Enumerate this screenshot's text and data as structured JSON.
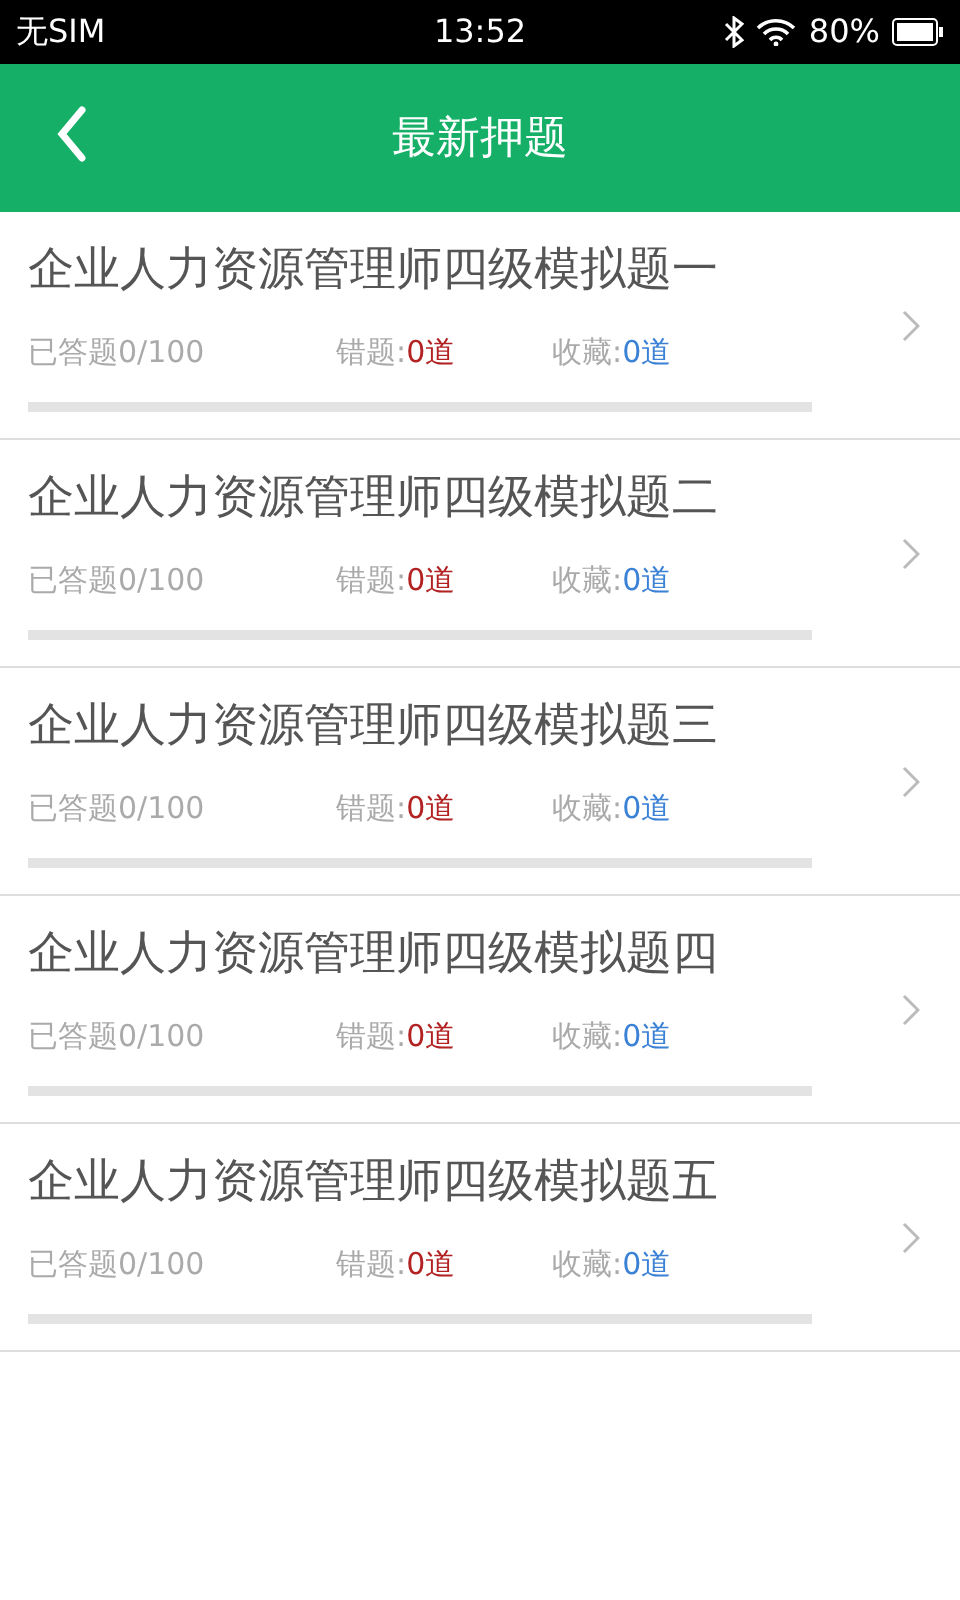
{
  "status_bar": {
    "carrier": "无SIM",
    "time": "13:52",
    "battery": "80%"
  },
  "nav": {
    "title": "最新押题"
  },
  "items": [
    {
      "title": "企业人力资源管理师四级模拟题一",
      "answered": "已答题0/100",
      "wrong_label": "错题:",
      "wrong_value": "0道",
      "fav_label": "收藏:",
      "fav_value": "0道",
      "level": 0
    },
    {
      "title": "企业人力资源管理师四级模拟题二",
      "answered": "已答题0/100",
      "wrong_label": "错题:",
      "wrong_value": "0道",
      "fav_label": "收藏:",
      "fav_value": "0道",
      "level": 0
    },
    {
      "title": "企业人力资源管理师四级模拟题三",
      "answered": "已答题0/100",
      "wrong_label": "错题:",
      "wrong_value": "0道",
      "fav_label": "收藏:",
      "fav_value": "0道",
      "level": 0
    },
    {
      "title": "企业人力资源管理师四级模拟题四",
      "answered": "已答题0/100",
      "wrong_label": "错题:",
      "wrong_value": "0道",
      "fav_label": "收藏:",
      "fav_value": "0道",
      "level": 0
    },
    {
      "title": "企业人力资源管理师四级模拟题五",
      "answered": "已答题0/100",
      "wrong_label": "错题:",
      "wrong_value": "0道",
      "fav_label": "收藏:",
      "fav_value": "0道",
      "level": 0
    }
  ]
}
